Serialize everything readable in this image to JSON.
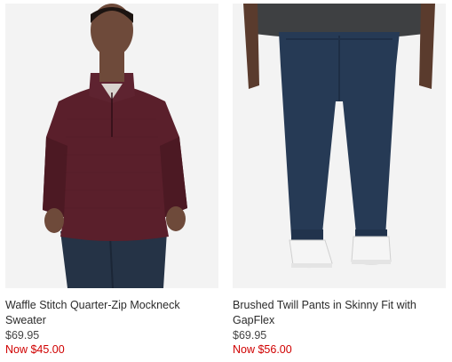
{
  "products": [
    {
      "title": "Waffle Stitch Quarter-Zip Mockneck Sweater",
      "price": "$69.95",
      "sale_price": "Now $45.00",
      "image_label": "sweater-photo",
      "colors": {
        "garment": "#5a1f2b",
        "background": "#f3f3f3"
      }
    },
    {
      "title": "Brushed Twill Pants in Skinny Fit with GapFlex",
      "price": "$69.95",
      "sale_price": "Now $56.00",
      "image_label": "pants-photo",
      "colors": {
        "garment": "#263a55",
        "background": "#f3f3f3"
      }
    }
  ],
  "colors": {
    "sale": "#d00000",
    "text": "#2b2b2b",
    "price": "#444444"
  }
}
